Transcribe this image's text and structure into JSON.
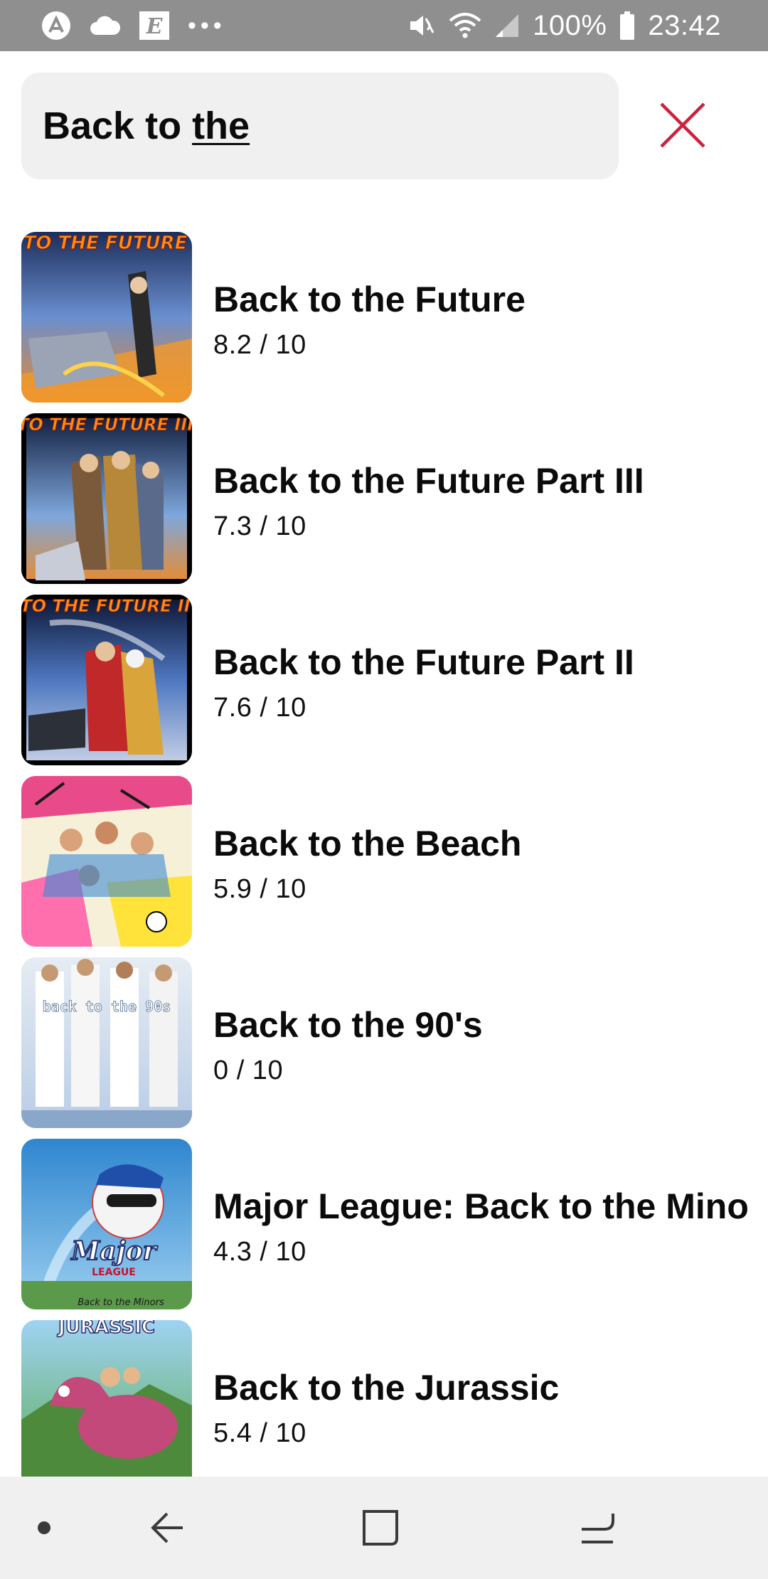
{
  "status_bar": {
    "battery_percent": "100%",
    "time": "23:42",
    "left_icons": [
      "app-launcher-icon",
      "cloud-icon",
      "e-app-icon",
      "more-notifications-icon"
    ],
    "right_icons": [
      "mute-icon",
      "wifi-icon",
      "signal-icon",
      "battery-icon"
    ],
    "background": "#8f8f8f"
  },
  "search": {
    "query_prefix": "Back to ",
    "query_underlined": "the",
    "clear_icon": "close-icon",
    "clear_color": "#d0203a"
  },
  "results": [
    {
      "title": "Back to the Future",
      "rating": "8.2 / 10",
      "poster": "poster-back-to-the-future"
    },
    {
      "title": "Back to the Future Part III",
      "rating": "7.3 / 10",
      "poster": "poster-back-to-the-future-3"
    },
    {
      "title": "Back to the Future Part II",
      "rating": "7.6 / 10",
      "poster": "poster-back-to-the-future-2"
    },
    {
      "title": "Back to the Beach",
      "rating": "5.9 / 10",
      "poster": "poster-back-to-the-beach"
    },
    {
      "title": "Back to the 90's",
      "rating": "0 / 10",
      "poster": "poster-back-to-the-90s"
    },
    {
      "title": "Major League: Back to the Minors",
      "rating": "4.3 / 10",
      "poster": "poster-major-league"
    },
    {
      "title": "Back to the Jurassic",
      "rating": "5.4 / 10",
      "poster": "poster-back-to-the-jurassic"
    }
  ],
  "poster_text": {
    "bttf": "TO THE FUTURE",
    "bttf3": "TO THE FUTURE III",
    "bttf2": "TO THE FUTURE II",
    "nineties": "back to the 90s",
    "major": "Major",
    "league": "LEAGUE",
    "minors": "Back to the Minors",
    "jurassic": "JURASSIC"
  },
  "nav_bar": {
    "items": [
      "nav-dot-icon",
      "back-icon",
      "home-icon",
      "recents-icon"
    ],
    "background": "#f0f0f0"
  }
}
